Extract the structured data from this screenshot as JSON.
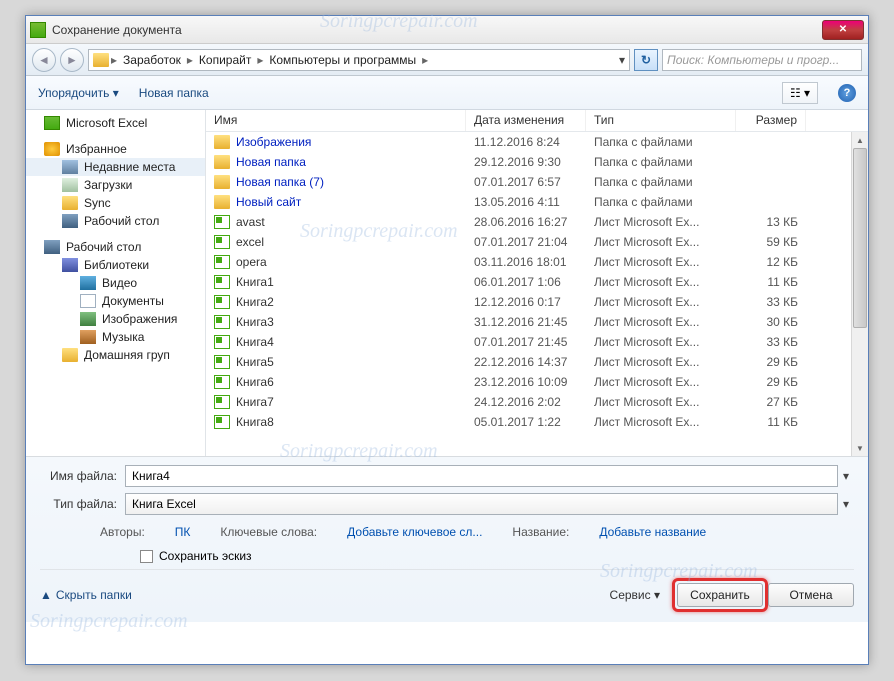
{
  "window": {
    "title": "Сохранение документа"
  },
  "breadcrumb": {
    "segments": [
      "Заработок",
      "Копирайт",
      "Компьютеры и программы"
    ]
  },
  "search": {
    "placeholder": "Поиск: Компьютеры и прогр..."
  },
  "toolbar": {
    "organize": "Упорядочить",
    "newfolder": "Новая папка"
  },
  "sidebar": {
    "excel": "Microsoft Excel",
    "favorites": "Избранное",
    "recent": "Недавние места",
    "downloads": "Загрузки",
    "sync": "Sync",
    "desktop": "Рабочий стол",
    "desktop2": "Рабочий стол",
    "libraries": "Библиотеки",
    "video": "Видео",
    "docs": "Документы",
    "images": "Изображения",
    "music": "Музыка",
    "homegroup": "Домашняя груп"
  },
  "columns": {
    "name": "Имя",
    "date": "Дата изменения",
    "type": "Тип",
    "size": "Размер"
  },
  "files": [
    {
      "name": "Изображения",
      "date": "11.12.2016 8:24",
      "type": "Папка с файлами",
      "size": "",
      "kind": "folder"
    },
    {
      "name": "Новая папка",
      "date": "29.12.2016 9:30",
      "type": "Папка с файлами",
      "size": "",
      "kind": "folder"
    },
    {
      "name": "Новая папка (7)",
      "date": "07.01.2017 6:57",
      "type": "Папка с файлами",
      "size": "",
      "kind": "folder"
    },
    {
      "name": "Новый сайт",
      "date": "13.05.2016 4:11",
      "type": "Папка с файлами",
      "size": "",
      "kind": "folder"
    },
    {
      "name": "avast",
      "date": "28.06.2016 16:27",
      "type": "Лист Microsoft Ex...",
      "size": "13 КБ",
      "kind": "xls"
    },
    {
      "name": "excel",
      "date": "07.01.2017 21:04",
      "type": "Лист Microsoft Ex...",
      "size": "59 КБ",
      "kind": "xls"
    },
    {
      "name": "opera",
      "date": "03.11.2016 18:01",
      "type": "Лист Microsoft Ex...",
      "size": "12 КБ",
      "kind": "xls"
    },
    {
      "name": "Книга1",
      "date": "06.01.2017 1:06",
      "type": "Лист Microsoft Ex...",
      "size": "11 КБ",
      "kind": "xls"
    },
    {
      "name": "Книга2",
      "date": "12.12.2016 0:17",
      "type": "Лист Microsoft Ex...",
      "size": "33 КБ",
      "kind": "xls"
    },
    {
      "name": "Книга3",
      "date": "31.12.2016 21:45",
      "type": "Лист Microsoft Ex...",
      "size": "30 КБ",
      "kind": "xls"
    },
    {
      "name": "Книга4",
      "date": "07.01.2017 21:45",
      "type": "Лист Microsoft Ex...",
      "size": "33 КБ",
      "kind": "xls"
    },
    {
      "name": "Книга5",
      "date": "22.12.2016 14:37",
      "type": "Лист Microsoft Ex...",
      "size": "29 КБ",
      "kind": "xls"
    },
    {
      "name": "Книга6",
      "date": "23.12.2016 10:09",
      "type": "Лист Microsoft Ex...",
      "size": "29 КБ",
      "kind": "xls"
    },
    {
      "name": "Книга7",
      "date": "24.12.2016 2:02",
      "type": "Лист Microsoft Ex...",
      "size": "27 КБ",
      "kind": "xls"
    },
    {
      "name": "Книга8",
      "date": "05.01.2017 1:22",
      "type": "Лист Microsoft Ex...",
      "size": "11 КБ",
      "kind": "xls"
    }
  ],
  "form": {
    "filename_label": "Имя файла:",
    "filename_value": "Книга4",
    "filetype_label": "Тип файла:",
    "filetype_value": "Книга Excel",
    "authors_label": "Авторы:",
    "authors_value": "ПК",
    "tags_label": "Ключевые слова:",
    "tags_value": "Добавьте ключевое сл...",
    "title_label": "Название:",
    "title_value": "Добавьте название",
    "thumbnail": "Сохранить эскиз"
  },
  "buttons": {
    "hide": "Скрыть папки",
    "service": "Сервис",
    "save": "Сохранить",
    "cancel": "Отмена"
  }
}
